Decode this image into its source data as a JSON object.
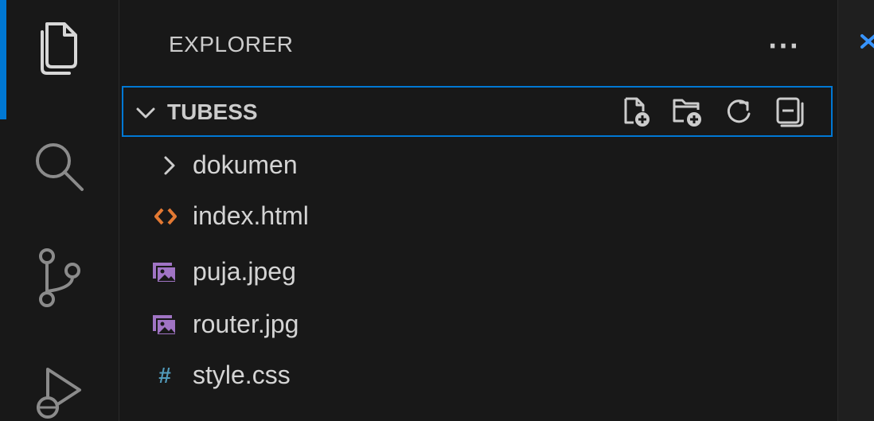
{
  "sidebar": {
    "title": "EXPLORER",
    "more_label": "···"
  },
  "section": {
    "title": "TUBESS",
    "actions": [
      {
        "icon": "new-file-icon"
      },
      {
        "icon": "new-folder-icon"
      },
      {
        "icon": "refresh-icon"
      },
      {
        "icon": "collapse-all-icon"
      }
    ]
  },
  "tree": {
    "items": [
      {
        "label": "dokumen",
        "type": "folder",
        "icon": "chevron-right-icon"
      },
      {
        "label": "index.html",
        "type": "html",
        "icon": "html-file-icon"
      },
      {
        "label": "puja.jpeg",
        "type": "image",
        "icon": "image-file-icon"
      },
      {
        "label": "router.jpg",
        "type": "image",
        "icon": "image-file-icon"
      },
      {
        "label": "style.css",
        "type": "css",
        "icon": "css-file-icon",
        "glyph": "#"
      }
    ]
  },
  "colors": {
    "accent": "#0078d4",
    "html_icon": "#e37933",
    "image_icon": "#a074c4",
    "css_icon": "#519aba",
    "text": "#cccccc"
  }
}
